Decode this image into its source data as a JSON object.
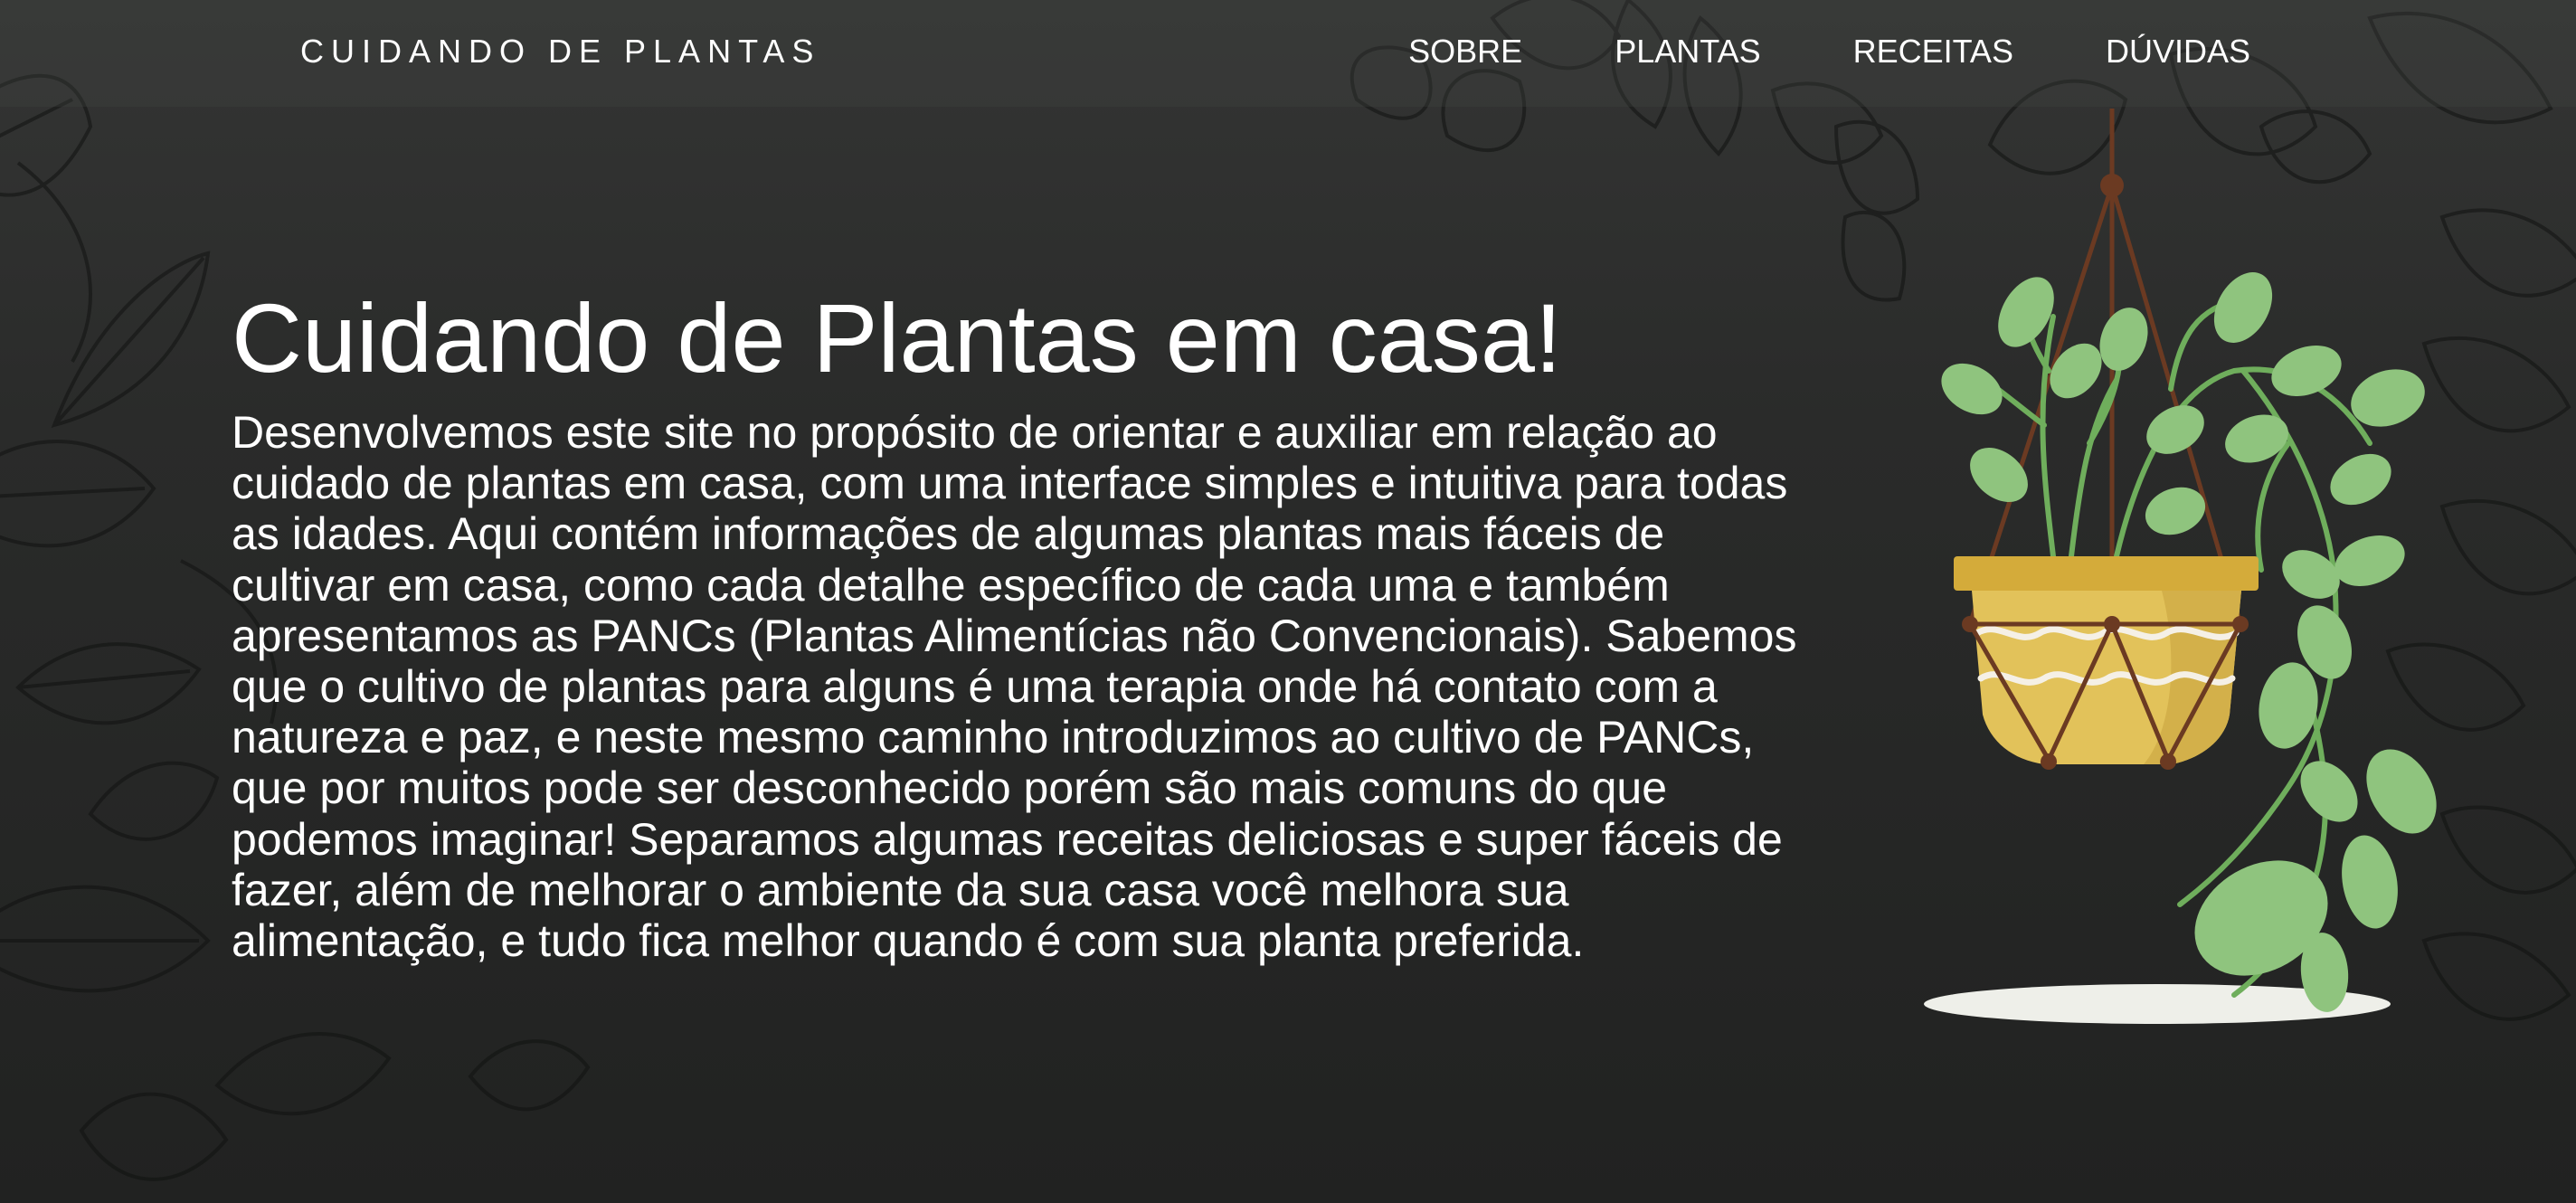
{
  "nav": {
    "brand": "CUIDANDO DE PLANTAS",
    "items": [
      {
        "label": "SOBRE"
      },
      {
        "label": "PLANTAS"
      },
      {
        "label": "RECEITAS"
      },
      {
        "label": "DÚVIDAS"
      }
    ]
  },
  "hero": {
    "title": "Cuidando de Plantas em casa!",
    "description": "Desenvolvemos este site no propósito de orientar e auxiliar em relação ao cuidado de plantas em casa, com uma interface simples e intuitiva para todas as idades. Aqui contém informações de algumas plantas mais fáceis de cultivar em casa, como cada detalhe específico de cada uma e também apresentamos as PANCs (Plantas Alimentícias não Convencionais). Sabemos que o cultivo de plantas para alguns é uma terapia onde há contato com a natureza e paz, e neste mesmo caminho introduzimos ao cultivo de PANCs, que por muitos pode ser desconhecido porém são mais comuns do que podemos imaginar! Separamos algumas receitas deliciosas e super fáceis de fazer, além de melhorar o ambiente da sua casa você melhora sua alimentação, e tudo fica melhor quando é com sua planta preferida."
  },
  "colors": {
    "background": "#222322",
    "text": "#ffffff",
    "leaf_green": "#8fc47e",
    "pot_yellow": "#e2c25a",
    "rope_brown": "#6b3a22"
  },
  "icons": {
    "illustration": "hanging-plant-illustration",
    "background": "botanical-line-pattern"
  }
}
